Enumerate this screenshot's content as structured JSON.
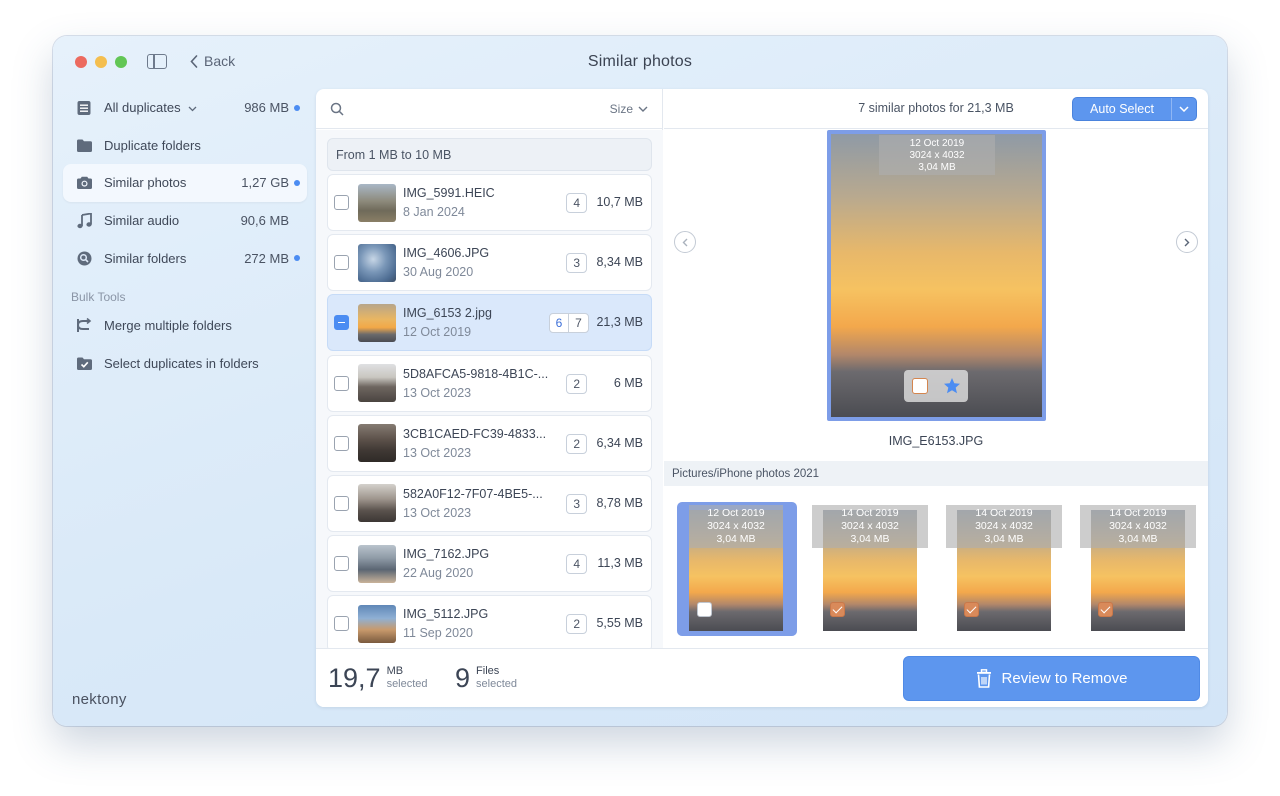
{
  "window": {
    "title": "Similar photos",
    "back_label": "Back"
  },
  "colors": {
    "accent": "#5d96ee",
    "selection": "#7d9de8",
    "dot": "#4b8cf2"
  },
  "sidebar": {
    "items": [
      {
        "label": "All duplicates",
        "size": "986 MB",
        "icon": "list-icon",
        "dot": true,
        "dropdown": true
      },
      {
        "label": "Duplicate folders",
        "size": "",
        "icon": "folder-icon",
        "dot": false
      },
      {
        "label": "Similar photos",
        "size": "1,27 GB",
        "icon": "camera-icon",
        "dot": true,
        "active": true
      },
      {
        "label": "Similar audio",
        "size": "90,6 MB",
        "icon": "music-note-icon",
        "dot": false
      },
      {
        "label": "Similar folders",
        "size": "272 MB",
        "icon": "folder-search-icon",
        "dot": true
      }
    ],
    "bulk_heading": "Bulk Tools",
    "tools": [
      {
        "label": "Merge multiple folders",
        "icon": "merge-icon"
      },
      {
        "label": "Select duplicates in folders",
        "icon": "folder-check-icon"
      }
    ],
    "brand": "nektony"
  },
  "list": {
    "sort_label": "Size",
    "group_header": "From 1 MB to 10 MB",
    "rows": [
      {
        "name": "IMG_5991.HEIC",
        "date": "8 Jan 2024",
        "count": "4",
        "size": "10,7 MB"
      },
      {
        "name": "IMG_4606.JPG",
        "date": "30 Aug 2020",
        "count": "3",
        "size": "8,34 MB"
      },
      {
        "name": "IMG_6153 2.jpg",
        "date": "12 Oct 2019",
        "count": "7",
        "selected_count": "6",
        "size": "21,3 MB",
        "selected": true
      },
      {
        "name": "5D8AFCA5-9818-4B1C-...",
        "date": "13 Oct 2023",
        "count": "2",
        "size": "6 MB"
      },
      {
        "name": "3CB1CAED-FC39-4833...",
        "date": "13 Oct 2023",
        "count": "2",
        "size": "6,34 MB"
      },
      {
        "name": "582A0F12-7F07-4BE5-...",
        "date": "13 Oct 2023",
        "count": "3",
        "size": "8,78 MB"
      },
      {
        "name": "IMG_7162.JPG",
        "date": "22 Aug 2020",
        "count": "4",
        "size": "11,3 MB"
      },
      {
        "name": "IMG_5112.JPG",
        "date": "11 Sep 2020",
        "count": "2",
        "size": "5,55 MB"
      }
    ]
  },
  "preview": {
    "summary": "7 similar photos for 21,3 MB",
    "auto_select_label": "Auto Select",
    "main_photo": {
      "date": "12 Oct 2019",
      "dimensions": "3024 x 4032",
      "size": "3,04 MB",
      "filename": "IMG_E6153.JPG"
    },
    "folder": "Pictures/iPhone photos 2021",
    "thumbnails": [
      {
        "date": "12 Oct 2019",
        "dimensions": "3024 x 4032",
        "size": "3,04 MB",
        "checked": false,
        "selected": true
      },
      {
        "date": "14 Oct 2019",
        "dimensions": "3024 x 4032",
        "size": "3,04 MB",
        "checked": true
      },
      {
        "date": "14 Oct 2019",
        "dimensions": "3024 x 4032",
        "size": "3,04 MB",
        "checked": true
      },
      {
        "date": "14 Oct 2019",
        "dimensions": "3024 x 4032",
        "size": "3,04 MB",
        "checked": true
      }
    ]
  },
  "footer": {
    "size_value": "19,7",
    "size_unit": "MB",
    "size_sub": "selected",
    "files_value": "9",
    "files_unit": "Files",
    "files_sub": "selected",
    "review_label": "Review to Remove"
  }
}
